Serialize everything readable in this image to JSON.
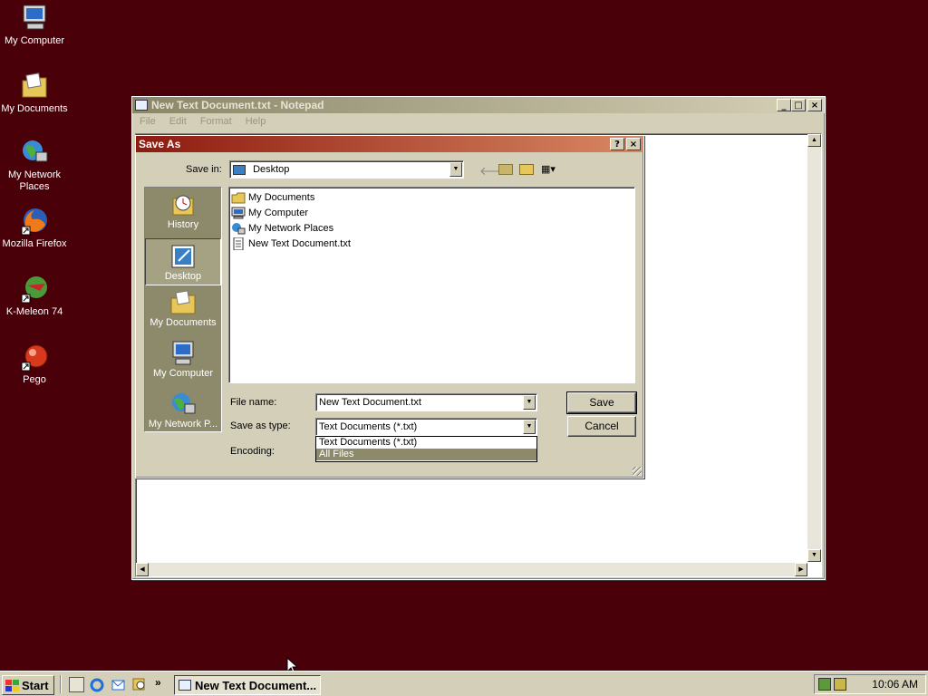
{
  "desktop": {
    "icons": [
      {
        "label": "My Computer",
        "icon": "my-computer-icon"
      },
      {
        "label": "My Documents",
        "icon": "folder-icon"
      },
      {
        "label": "My Network Places",
        "icon": "network-places-icon"
      },
      {
        "label": "Mozilla Firefox",
        "icon": "firefox-icon"
      },
      {
        "label": "K-Meleon 74",
        "icon": "k-meleon-icon"
      },
      {
        "label": "Pego",
        "icon": "pego-icon"
      }
    ]
  },
  "notepad": {
    "title": "New Text Document.txt - Notepad",
    "menu": [
      "File",
      "Edit",
      "Format",
      "Help"
    ],
    "controls": {
      "minimize": "_",
      "maximize": "□",
      "close": "×"
    }
  },
  "save_dialog": {
    "title": "Save As",
    "help_btn": "?",
    "close_btn": "×",
    "save_in_label": "Save in:",
    "save_in_value": "Desktop",
    "places": [
      {
        "label": "History",
        "icon": "history-icon"
      },
      {
        "label": "Desktop",
        "icon": "desktop-icon",
        "selected": true
      },
      {
        "label": "My Documents",
        "icon": "folder-icon"
      },
      {
        "label": "My Computer",
        "icon": "my-computer-icon"
      },
      {
        "label": "My Network P...",
        "icon": "network-places-icon"
      }
    ],
    "files": [
      {
        "name": "My Documents",
        "icon": "folder-icon"
      },
      {
        "name": "My Computer",
        "icon": "my-computer-icon"
      },
      {
        "name": "My Network Places",
        "icon": "network-places-icon"
      },
      {
        "name": "New Text Document.txt",
        "icon": "text-file-icon"
      }
    ],
    "filename_label": "File name:",
    "filename_value": "New Text Document.txt",
    "type_label": "Save as type:",
    "type_value": "Text Documents (*.txt)",
    "type_options": [
      "Text Documents (*.txt)",
      "All Files"
    ],
    "type_highlighted": "All Files",
    "encoding_label": "Encoding:",
    "save_button": "Save",
    "cancel_button": "Cancel"
  },
  "taskbar": {
    "start_label": "Start",
    "chevron": "»",
    "task_label": "New Text Document...",
    "clock": "10:06 AM"
  },
  "colors": {
    "desktop": "#4a0009",
    "active_title_start": "#8d1a0f",
    "active_title_end": "#d98863",
    "selection": "#8d8a6c"
  }
}
